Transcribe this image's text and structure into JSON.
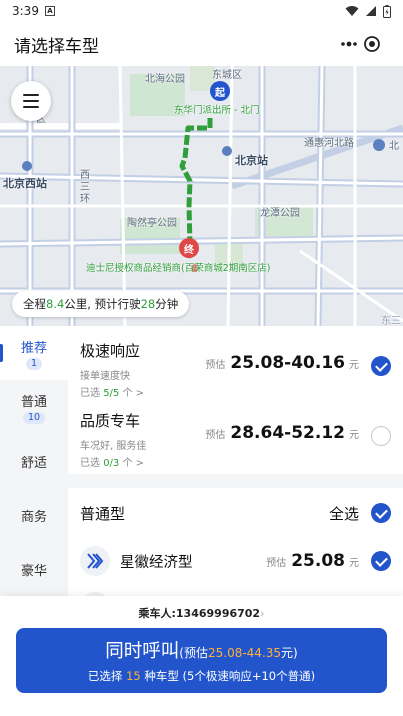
{
  "status_bar": {
    "time": "3:39",
    "notification_badge": "A"
  },
  "header": {
    "title": "请选择车型"
  },
  "map": {
    "labels": {
      "beihai_park": "北海公园",
      "dongcheng": "东城区",
      "start_place": "东华门派出所 - 北门",
      "tonghui_river": "通惠河北路",
      "beijing_station": "北京站",
      "beijing_west": "北京西站",
      "west_ring": "西三环",
      "taoranting": "陶然亭公园",
      "longtan": "龙潭公园",
      "end_place": "迪士尼授权商品经销商(百荣商城2期南区店)",
      "xicheng_partial": "区",
      "bei_partial": "北",
      "dongsan_partial": "东三"
    },
    "start_marker": "起",
    "end_marker": "终",
    "route_color": "#2f9e3b",
    "trip_summary": {
      "prefix": "全程",
      "distance": "8.4",
      "mid": "公里, 预计行驶",
      "minutes": "28",
      "suffix": "分钟"
    }
  },
  "categories": [
    {
      "label": "推荐",
      "count": "1",
      "active": true
    },
    {
      "label": "普通",
      "count": "10",
      "active": false
    },
    {
      "label": "舒适",
      "count": "",
      "active": false
    },
    {
      "label": "商务",
      "count": "",
      "active": false
    },
    {
      "label": "豪华",
      "count": "",
      "active": false
    }
  ],
  "ride_options": [
    {
      "name": "极速响应",
      "desc": "接单速度快",
      "selected_prefix": "已选 ",
      "selected_count": "5/5",
      "selected_suffix": " 个 >",
      "est_label": "预估",
      "price": "25.08-40.16",
      "unit": "元",
      "checked": true
    },
    {
      "name": "品质专车",
      "desc": "车况好, 服务佳",
      "selected_prefix": "已选 ",
      "selected_count": "0/3",
      "selected_suffix": " 个 >",
      "est_label": "预估",
      "price": "28.64-52.12",
      "unit": "元",
      "checked": false
    }
  ],
  "group": {
    "name": "普通型",
    "select_all": "全选",
    "checked": true
  },
  "models": [
    {
      "name": "星徽经济型",
      "est_label": "预估",
      "price": "25.08",
      "unit": "元",
      "checked": true
    }
  ],
  "bottom": {
    "passenger_label": "乘车人:",
    "passenger_phone": "13469996702",
    "call_button": {
      "title": "同时呼叫",
      "est_prefix": "(预估",
      "est_range": "25.08-44.35",
      "est_suffix": "元)",
      "selected_prefix": "已选择 ",
      "selected_count": "15",
      "selected_suffix": " 种车型 (5个极速响应+10个普通)"
    }
  },
  "colors": {
    "accent": "#2255cc",
    "green": "#2f9e3b",
    "orange": "#ffb03a"
  }
}
